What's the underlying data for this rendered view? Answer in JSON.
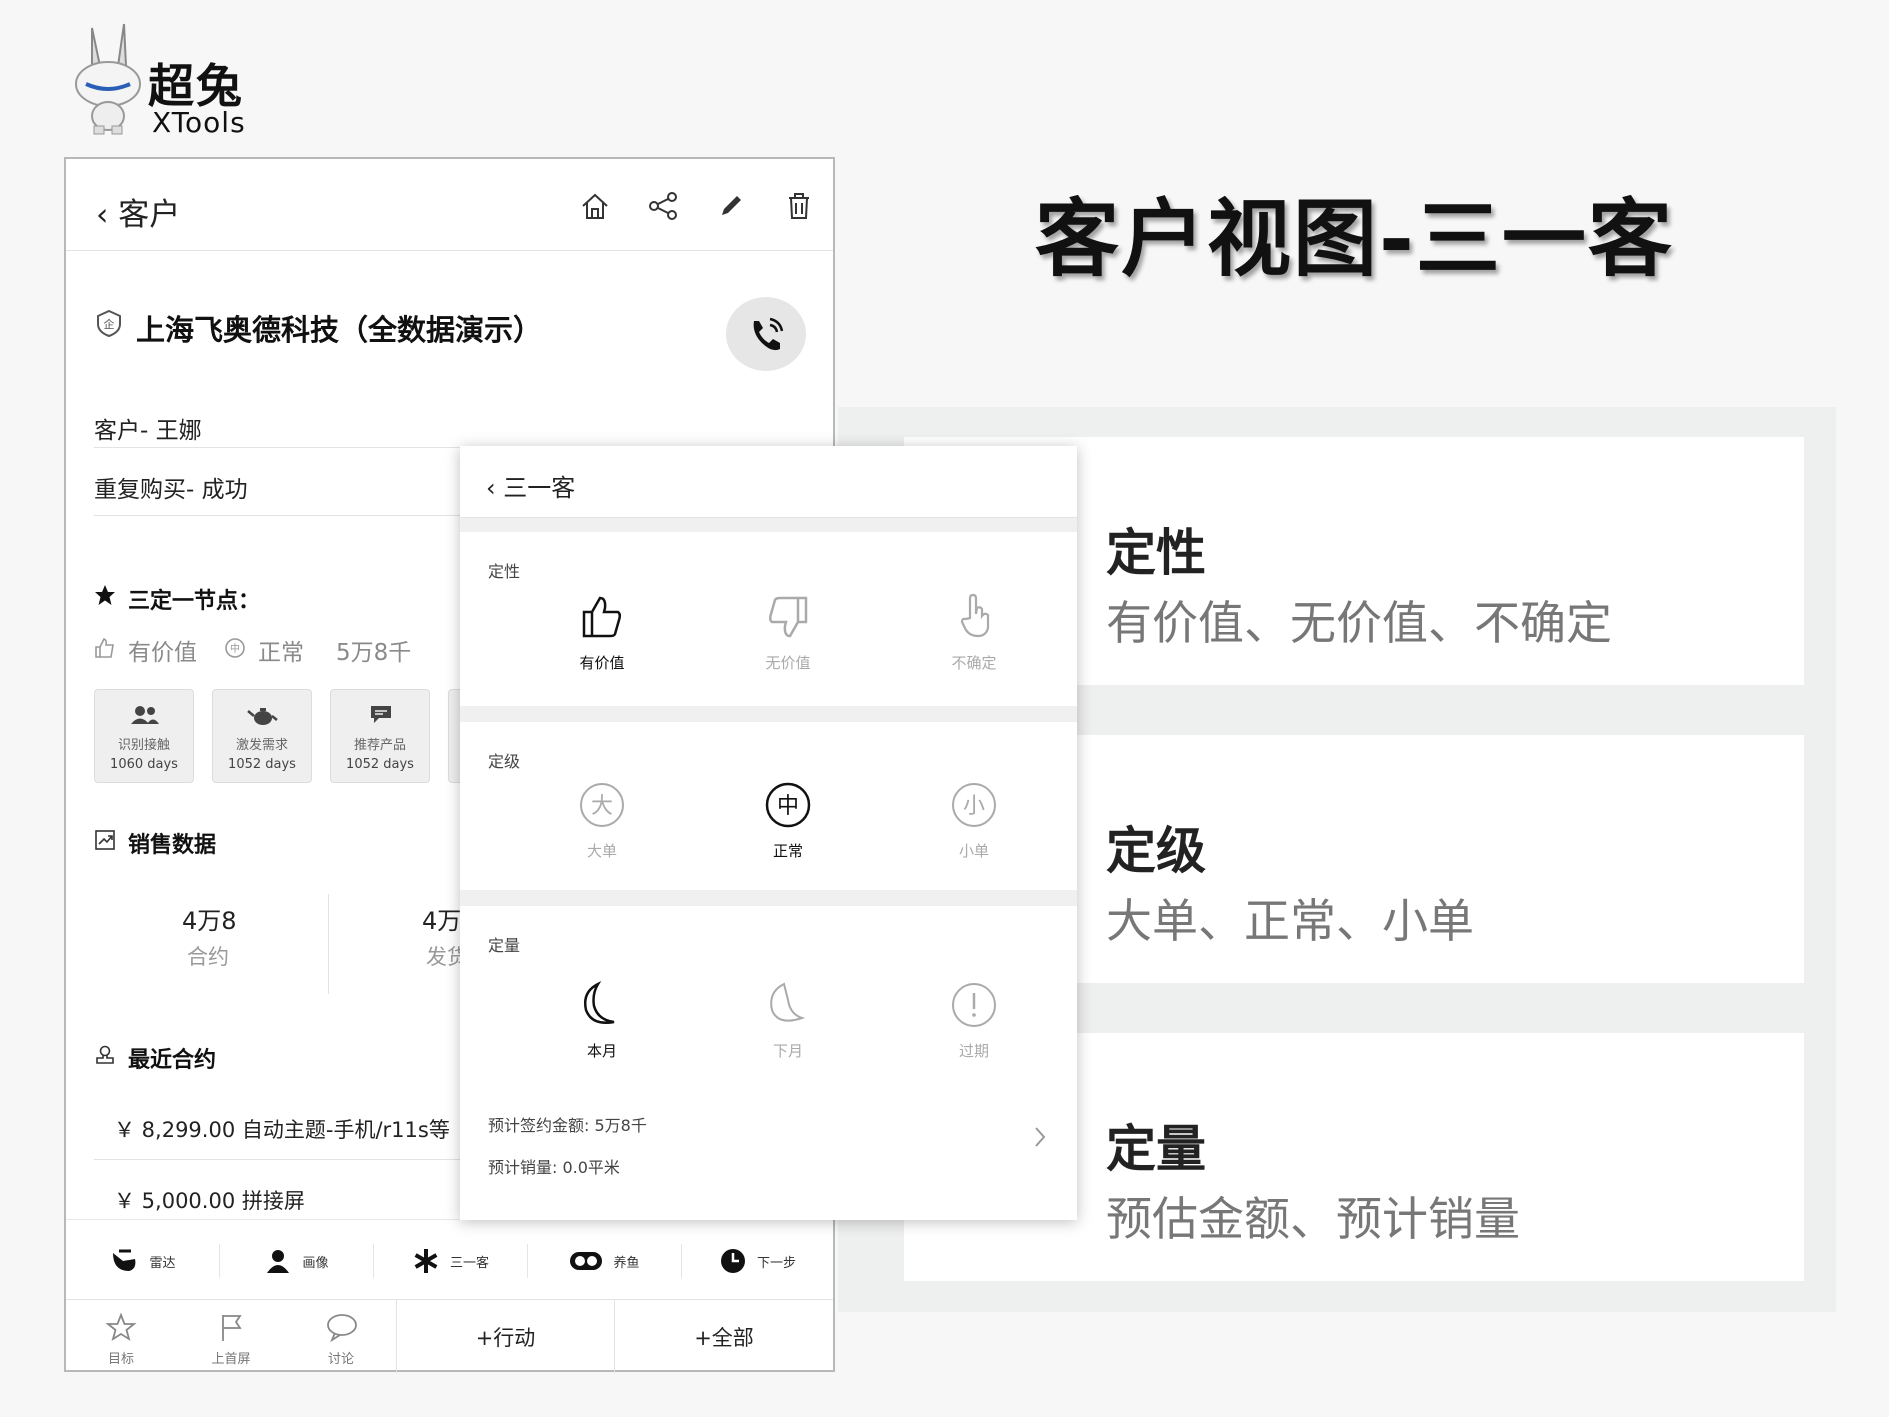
{
  "logo": {
    "cn": "超兔",
    "en": "XTools"
  },
  "main_title": "客户视图-三一客",
  "phone": {
    "header": {
      "back_label": "客户",
      "icons": [
        "home-icon",
        "share-icon",
        "edit-icon",
        "delete-icon"
      ]
    },
    "company": "上海飞奥德科技（全数据演示）",
    "contact_row": "客户- 王娜",
    "status_row": "重复购买- 成功",
    "nodes": {
      "title": "三定一节点：",
      "tags": [
        "有价值",
        "正常",
        "5万8千"
      ],
      "cards": [
        {
          "label": "识别接触",
          "days": "1060 days"
        },
        {
          "label": "激发需求",
          "days": "1052 days"
        },
        {
          "label": "推荐产品",
          "days": "1052 days"
        }
      ]
    },
    "sales": {
      "title": "销售数据",
      "stats": [
        {
          "value": "4万8",
          "label": "合约"
        },
        {
          "value": "4万",
          "label": "发货"
        }
      ]
    },
    "recent": {
      "title": "最近合约",
      "orders": [
        "￥ 8,299.00  自动主题-手机/r11s等",
        "￥ 5,000.00  拼接屏"
      ]
    },
    "tabs": [
      "雷达",
      "画像",
      "三一客",
      "养鱼",
      "下一步"
    ],
    "bottom": {
      "items": [
        "目标",
        "上首屏",
        "讨论"
      ],
      "buttons": [
        "+行动",
        "+全部"
      ]
    }
  },
  "modal": {
    "back_label": "三一客",
    "sections": [
      {
        "label": "定性",
        "options": [
          {
            "text": "有价值",
            "active": true
          },
          {
            "text": "无价值",
            "active": false
          },
          {
            "text": "不确定",
            "active": false
          }
        ]
      },
      {
        "label": "定级",
        "options": [
          {
            "text": "大单",
            "glyph": "大",
            "active": false
          },
          {
            "text": "正常",
            "glyph": "中",
            "active": true
          },
          {
            "text": "小单",
            "glyph": "小",
            "active": false
          }
        ]
      },
      {
        "label": "定量",
        "options": [
          {
            "text": "本月",
            "active": true
          },
          {
            "text": "下月",
            "active": false
          },
          {
            "text": "过期",
            "active": false
          }
        ]
      }
    ],
    "info": [
      "预计签约金额: 5万8千",
      "预计销量: 0.0平米"
    ]
  },
  "right": {
    "cards": [
      {
        "title": "定性",
        "subtitle": "有价值、无价值、不确定"
      },
      {
        "title": "定级",
        "subtitle": "大单、正常、小单"
      },
      {
        "title": "定量",
        "subtitle": "预估金额、预计销量"
      }
    ]
  }
}
